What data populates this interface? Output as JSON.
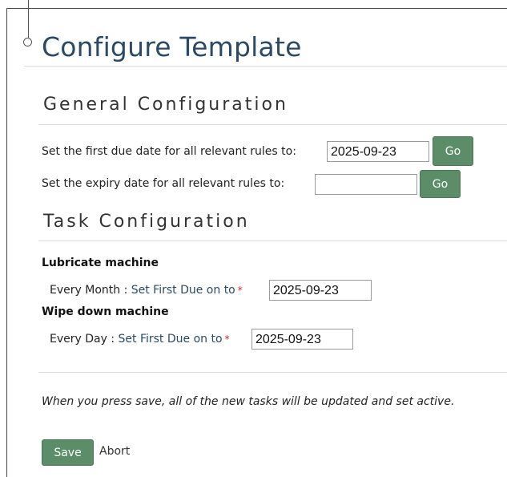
{
  "page": {
    "title": "Configure Template"
  },
  "general": {
    "heading": "General Configuration",
    "first_due_label": "Set the first due date for all relevant rules to:",
    "first_due_value": "2025-09-23",
    "expiry_label": "Set the expiry date for all relevant rules to:",
    "expiry_value": "",
    "go_label": "Go"
  },
  "tasks": {
    "heading": "Task Configuration",
    "items": [
      {
        "name": "Lubricate machine",
        "frequency": "Every Month : ",
        "due_label": "Set First Due on to",
        "required": "*",
        "due_value": "2025-09-23"
      },
      {
        "name": "Wipe down machine",
        "frequency": "Every Day : ",
        "due_label": "Set First Due on to",
        "required": "*",
        "due_value": "2025-09-23"
      }
    ]
  },
  "footer": {
    "note": "When you press save, all of the new tasks will be updated and set active.",
    "save_label": "Save",
    "abort_label": "Abort"
  },
  "colors": {
    "button_green": "#5b8d68",
    "title_blue": "#2a4a66",
    "required_red": "#d22222"
  }
}
